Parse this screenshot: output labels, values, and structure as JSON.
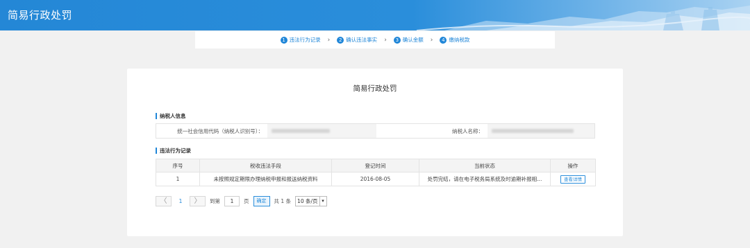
{
  "header": {
    "title": "简易行政处罚"
  },
  "steps": [
    {
      "num": "1",
      "label": "违法行为记录"
    },
    {
      "num": "2",
      "label": "确认违法事实"
    },
    {
      "num": "3",
      "label": "确认金额"
    },
    {
      "num": "4",
      "label": "缴纳税款"
    }
  ],
  "card": {
    "title": "简易行政处罚",
    "taxpayer_section": "纳税人信息",
    "credit_code_label": "统一社会信用代码（纳税人识别号）：",
    "name_label": "纳税人名称：",
    "records_section": "违法行为记录"
  },
  "table": {
    "headers": [
      "序号",
      "税收违法手段",
      "登记时间",
      "当前状态",
      "操作"
    ],
    "rows": [
      {
        "index": "1",
        "method": "未按照规定期限办理纳税申报和报送纳税资料",
        "date": "2016-08-05",
        "status": "处罚完结，请在电子税务局系统及时逾期补报相...",
        "action": "查看详情"
      }
    ]
  },
  "pager": {
    "prev_icon": "chevron-left-icon",
    "next_icon": "chevron-right-icon",
    "prev": "〈",
    "next": "〉",
    "current_page": "1",
    "goto_label": "到第",
    "goto_value": "1",
    "page_unit": "页",
    "confirm": "确定",
    "total": "共 1 条",
    "page_size": "10 条/页",
    "caret": "▾"
  }
}
